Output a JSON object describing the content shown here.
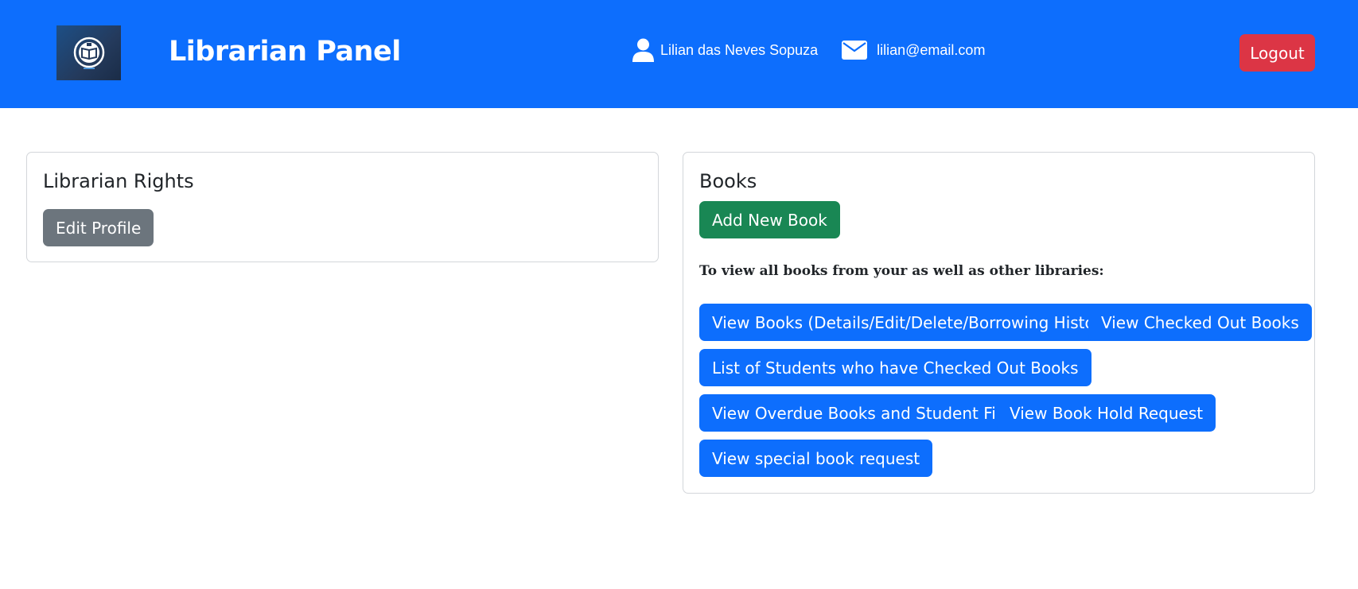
{
  "header": {
    "logo_icon": "library-book-logo-icon",
    "title": "Librarian Panel",
    "user_name": "Lilian das Neves Sopuza",
    "user_icon": "user-icon",
    "email": "lilian@email.com",
    "email_icon": "envelope-icon",
    "logout_label": "Logout",
    "bg_color": "#0d6efd",
    "logout_color": "#dc3545"
  },
  "rights_card": {
    "title": "Librarian Rights",
    "edit_profile_label": "Edit Profile"
  },
  "books_card": {
    "title": "Books",
    "add_book_label": "Add New Book",
    "note": "To view all books from your as well as other libraries:",
    "buttons": [
      "View Books (Details/Edit/Delete/Borrowing History)",
      "View Checked Out Books",
      "List of Students who have Checked Out Books",
      "View Overdue Books and Student Fine",
      "View Book Hold Request",
      "View special book request"
    ]
  }
}
